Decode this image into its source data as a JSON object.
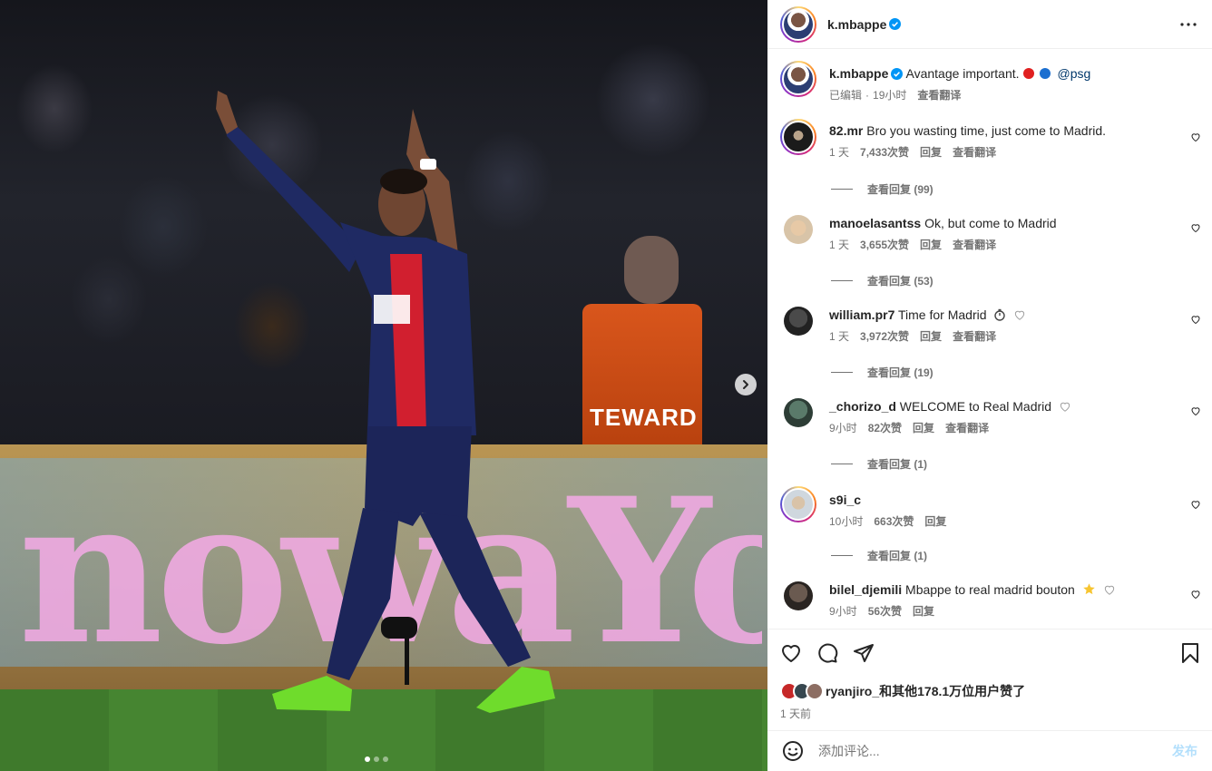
{
  "media": {
    "board_letters": "nowaYo",
    "steward_text": "TEWARD",
    "slides_total": 3,
    "slide_active": 1
  },
  "header": {
    "username": "k.mbappe"
  },
  "caption": {
    "username": "k.mbappe",
    "text": "Avantage important.",
    "mention": "@psg",
    "edited": "已编辑",
    "separator": "·",
    "time": "19小时",
    "translate": "查看翻译"
  },
  "comments": [
    {
      "username": "82.mr",
      "text": "Bro you wasting time, just come to Madrid.",
      "time": "1 天",
      "likes": "7,433次赞",
      "reply": "回复",
      "translate": "查看翻译",
      "replies": "查看回复 (99)"
    },
    {
      "username": "manoelasantss",
      "text": "Ok, but come to Madrid",
      "time": "1 天",
      "likes": "3,655次赞",
      "reply": "回复",
      "translate": "查看翻译",
      "replies": "查看回复 (53)"
    },
    {
      "username": "william.pr7",
      "text": "Time for Madrid",
      "time": "1 天",
      "likes": "3,972次赞",
      "reply": "回复",
      "translate": "查看翻译",
      "replies": "查看回复 (19)"
    },
    {
      "username": "_chorizo_d",
      "text": "WELCOME to Real Madrid",
      "time": "9小时",
      "likes": "82次赞",
      "reply": "回复",
      "translate": "查看翻译",
      "replies": "查看回复 (1)"
    },
    {
      "username": "s9i_c",
      "text": "",
      "time": "10小时",
      "likes": "663次赞",
      "reply": "回复",
      "translate": "",
      "replies": "查看回复 (1)"
    },
    {
      "username": "bilel_djemili",
      "text": "Mbappe to real madrid bouton",
      "time": "9小时",
      "likes": "56次赞",
      "reply": "回复",
      "translate": "",
      "replies": ""
    }
  ],
  "likes": {
    "first_user": "ryanjiro_",
    "rest": "和其他178.1万位用户赞了"
  },
  "post_time": "1 天前",
  "add_comment": {
    "placeholder": "添加评论...",
    "post_label": "发布"
  },
  "colors": {
    "verified": "#0095f6",
    "link": "#00376b",
    "muted": "#737373",
    "post_disabled": "#b2dffc"
  }
}
